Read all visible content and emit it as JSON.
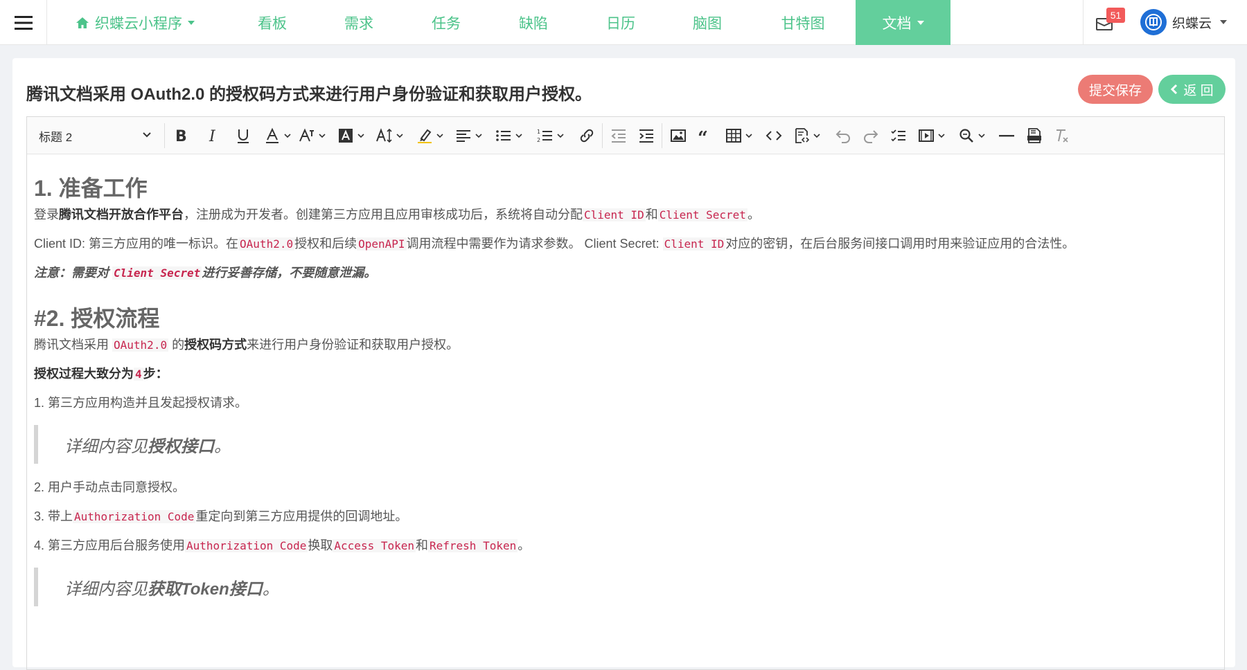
{
  "nav": {
    "project": "织蝶云小程序",
    "items": [
      "看板",
      "需求",
      "任务",
      "缺陷",
      "日历",
      "脑图",
      "甘特图"
    ],
    "active": "文档",
    "mail_count": "51",
    "user_name": "织蝶云",
    "accent_color": "#63cf9c"
  },
  "doc": {
    "title": "腾讯文档采用 OAuth2.0 的授权码方式来进行用户身份验证和获取用户授权。",
    "save_label": "提交保存",
    "back_label": "返 回"
  },
  "toolbar": {
    "heading": "标题 2"
  },
  "content": {
    "h1_a": "1. 准备工作",
    "p1_a": "登录",
    "p1_b": "腾讯文档开放合作平台",
    "p1_c": "，注册成为开发者。创建第三方应用且应用审核成功后，系统将自动分配",
    "p1_code1": "Client ID",
    "p1_d": "和",
    "p1_code2": "Client Secret",
    "p1_e": "。",
    "p2_a": "Client ID: 第三方应用的唯一标识。在",
    "p2_code1": "OAuth2.0",
    "p2_b": "授权和后续",
    "p2_code2": "OpenAPI",
    "p2_c": "调用流程中需要作为请求参数。 Client Secret: ",
    "p2_code3": "Client ID",
    "p2_d": "对应的密钥，在后台服务间接口调用时用来验证应用的合法性。",
    "note_a": "注意：需要对 ",
    "note_code": "Client Secret",
    "note_b": "进行妥善存储，不要随意泄漏。",
    "h1_b": "#2. 授权流程",
    "p3_a": "腾讯文档采用 ",
    "p3_code": "OAuth2.0",
    "p3_b": " 的",
    "p3_c": "授权码方式",
    "p3_d": "来进行用户身份验证和获取用户授权。",
    "p4_a": "授权过程大致分为",
    "p4_code": "4",
    "p4_b": "步：",
    "step1": "1. 第三方应用构造并且发起授权请求。",
    "quote1_a": "详细内容见 ",
    "quote1_b": "授权接口",
    "quote1_c": "。",
    "step2": "2. 用户手动点击同意授权。",
    "step3_a": "3. 带上",
    "step3_code": "Authorization Code",
    "step3_b": "重定向到第三方应用提供的回调地址。",
    "step4_a": "4. 第三方应用后台服务使用",
    "step4_code1": "Authorization Code",
    "step4_b": "换取",
    "step4_code2": "Access Token",
    "step4_c": "和",
    "step4_code3": "Refresh Token",
    "step4_d": "。",
    "quote2_a": "详细内容见",
    "quote2_b": "获取Token接口",
    "quote2_c": "。"
  }
}
